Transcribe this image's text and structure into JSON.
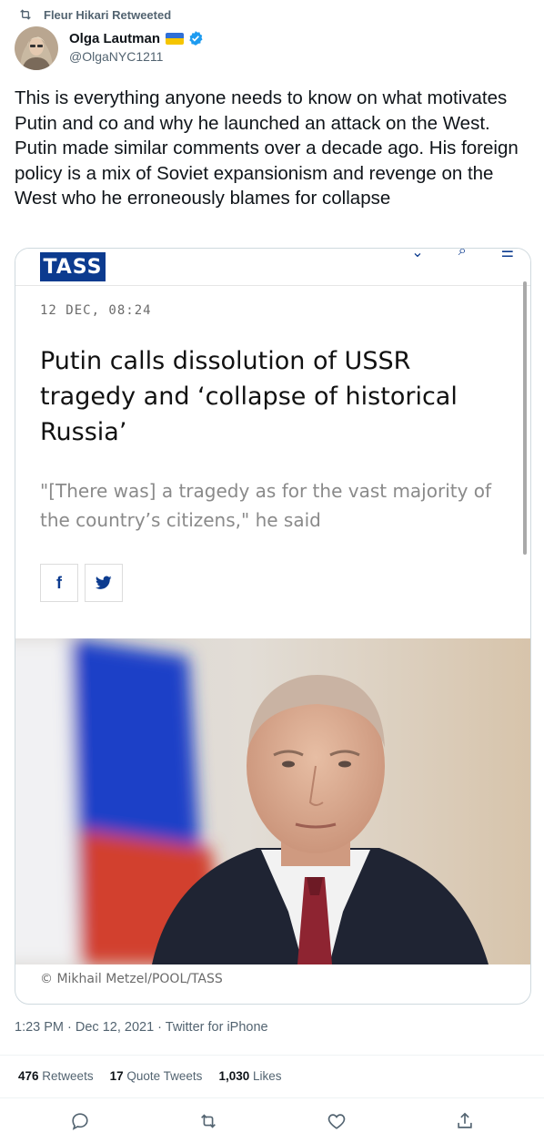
{
  "social_context": {
    "text": "Fleur Hikari Retweeted",
    "icon": "retweet-icon"
  },
  "author": {
    "name": "Olga Lautman",
    "handle": "@OlgaNYC1211",
    "badges": [
      "ukraine-flag-icon",
      "verified-badge-icon"
    ]
  },
  "tweet": {
    "text": "This is everything anyone needs to know on what motivates Putin and co and why he launched an attack on the West. Putin made similar comments over a decade ago. His foreign policy is a mix of Soviet expansionism and revenge on the West who he erroneously blames for collapse"
  },
  "embedded_article": {
    "logo": "TASS",
    "date": "12 DEC, 08:24",
    "headline": "Putin calls dissolution of USSR tragedy and ‘collapse of historical Russia’",
    "lead": "\"[There was] a tragedy as for the vast majority of the country’s citizens,\" he said",
    "share_facebook": "f",
    "photo_caption": "© Mikhail Metzel/POOL/TASS",
    "colors": {
      "brand": "#0c3b8f"
    }
  },
  "meta": {
    "time": "1:23 PM",
    "date": "Dec 12, 2021",
    "source": "Twitter for iPhone"
  },
  "stats": {
    "retweets_count": "476",
    "retweets_label": "Retweets",
    "quotes_count": "17",
    "quotes_label": "Quote Tweets",
    "likes_count": "1,030",
    "likes_label": "Likes"
  },
  "actions": [
    "reply-icon",
    "retweet-icon",
    "like-icon",
    "share-icon"
  ]
}
